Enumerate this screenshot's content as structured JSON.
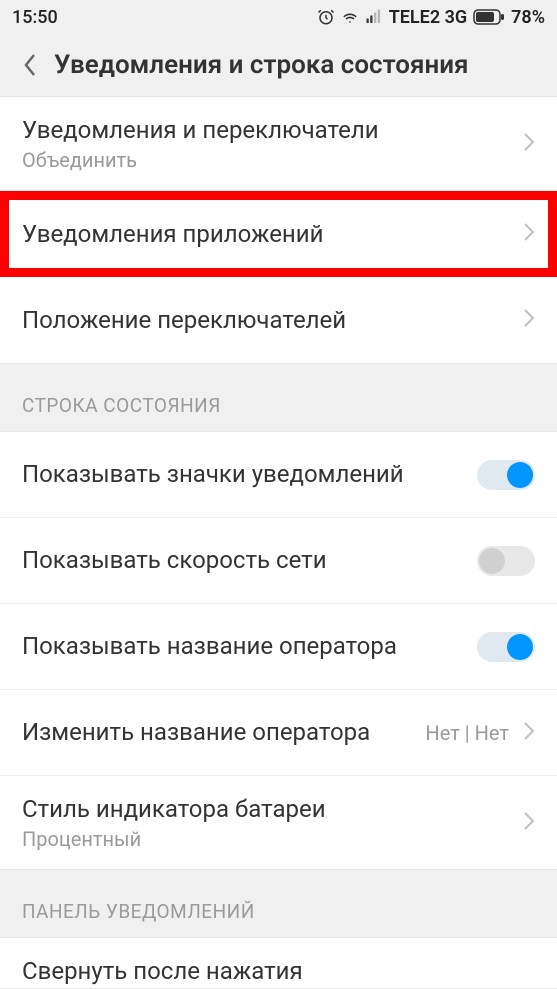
{
  "statusBar": {
    "time": "15:50",
    "carrier": "TELE2 3G",
    "battery": "78%"
  },
  "header": {
    "title": "Уведомления и строка состояния"
  },
  "section1": {
    "items": [
      {
        "title": "Уведомления и переключатели",
        "subtitle": "Объединить"
      },
      {
        "title": "Уведомления приложений"
      },
      {
        "title": "Положение переключателей"
      }
    ]
  },
  "section2": {
    "header": "СТРОКА СОСТОЯНИЯ",
    "items": [
      {
        "title": "Показывать значки уведомлений",
        "toggle": true
      },
      {
        "title": "Показывать скорость сети",
        "toggle": false
      },
      {
        "title": "Показывать название оператора",
        "toggle": true
      },
      {
        "title": "Изменить название оператора",
        "value": "Нет | Нет"
      },
      {
        "title": "Стиль индикатора батареи",
        "subtitle": "Процентный"
      }
    ]
  },
  "section3": {
    "header": "ПАНЕЛЬ УВЕДОМЛЕНИЙ",
    "items": [
      {
        "title": "Свернуть после нажатия"
      }
    ]
  }
}
